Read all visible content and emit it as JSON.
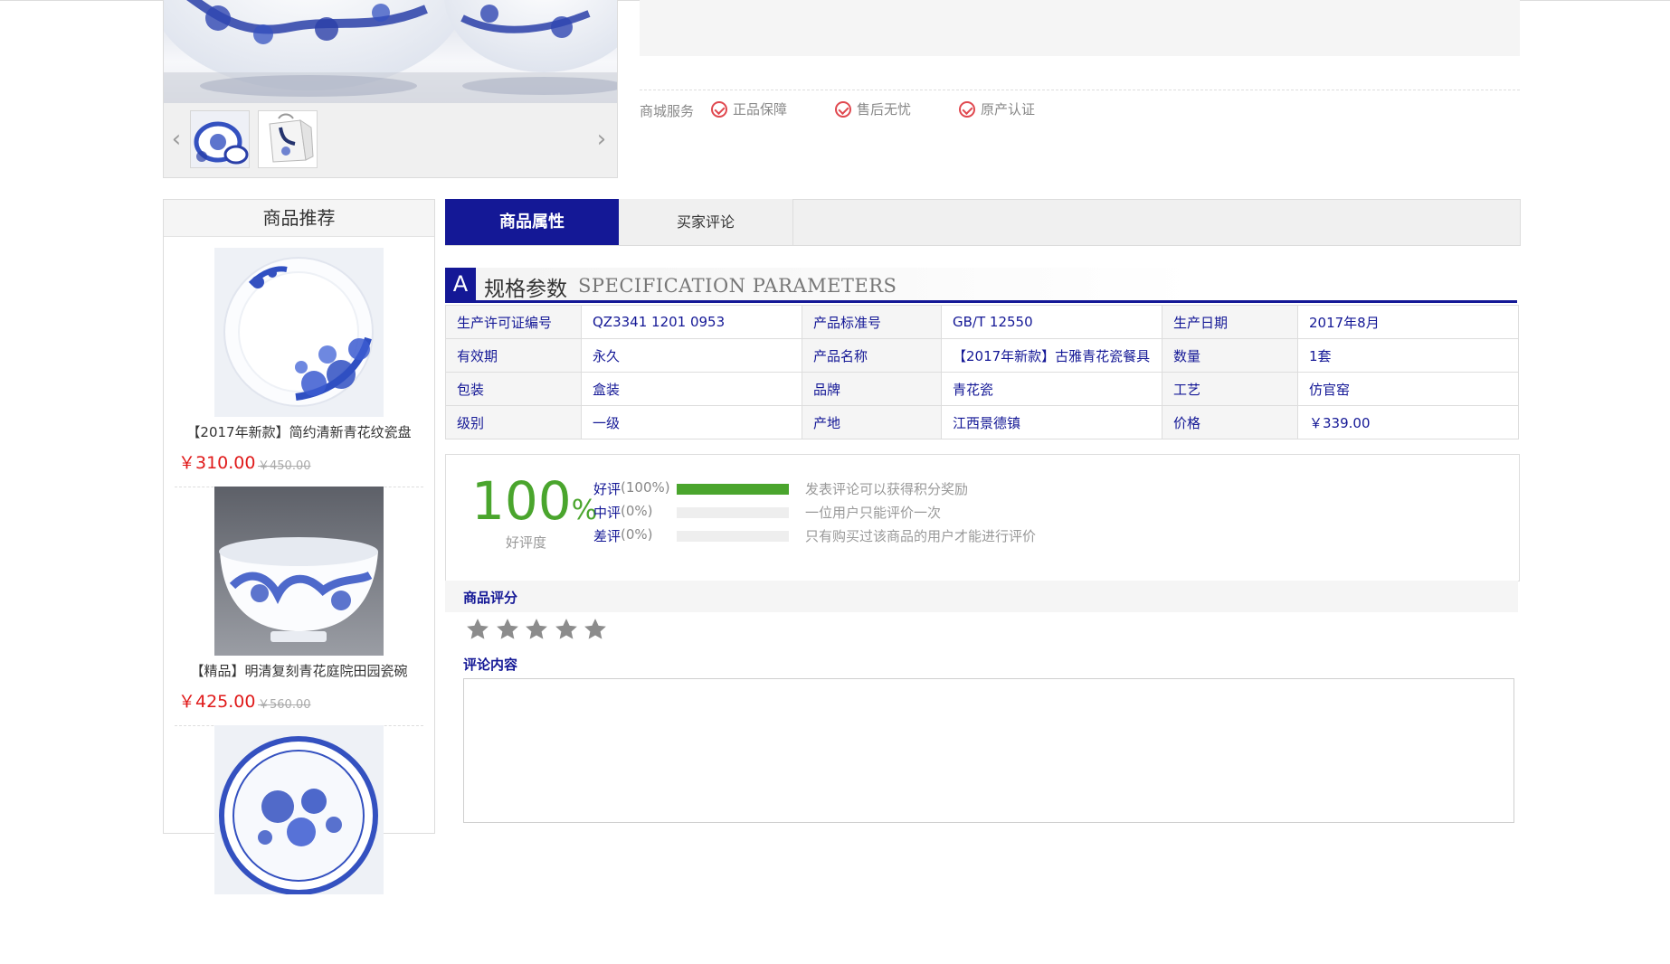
{
  "gallery": {
    "prev_icon": "chevron-left-icon",
    "next_icon": "chevron-right-icon",
    "thumbnails": [
      "blue-white-dinnerware-set",
      "gift-box-packaging"
    ]
  },
  "services": {
    "label": "商城服务",
    "items": [
      "正品保障",
      "售后无忧",
      "原产认证"
    ],
    "icon": "check-circle-icon",
    "icon_color": "#e0484f"
  },
  "sidebar": {
    "title": "商品推荐",
    "items": [
      {
        "name": "【2017年新款】简约清新青花纹瓷盘",
        "price": "￥310.00",
        "old_price": "￥450.00"
      },
      {
        "name": "【精品】明清复刻青花庭院田园瓷碗",
        "price": "￥425.00",
        "old_price": "￥560.00"
      }
    ]
  },
  "tabs": [
    {
      "label": "商品属性",
      "active": true
    },
    {
      "label": "买家评论",
      "active": false
    }
  ],
  "spec": {
    "letter": "A",
    "title_cn": "规格参数",
    "title_en": "SPECIFICATION PARAMETERS",
    "rows": [
      [
        [
          "生产许可证编号",
          "QZ3341 1201 0953"
        ],
        [
          "产品标准号",
          "GB/T 12550"
        ],
        [
          "生产日期",
          "2017年8月"
        ]
      ],
      [
        [
          "有效期",
          "永久"
        ],
        [
          "产品名称",
          "【2017年新款】古雅青花瓷餐具"
        ],
        [
          "数量",
          "1套"
        ]
      ],
      [
        [
          "包装",
          "盒装"
        ],
        [
          "品牌",
          "青花瓷"
        ],
        [
          "工艺",
          "仿官窑"
        ]
      ],
      [
        [
          "级别",
          "一级"
        ],
        [
          "产地",
          "江西景德镇"
        ],
        [
          "价格",
          "￥339.00"
        ]
      ]
    ]
  },
  "rating": {
    "percent": "100",
    "percent_sign": "%",
    "label": "好评度",
    "rows": [
      {
        "name": "好评",
        "pct": "(100%)",
        "fill": 1.0,
        "tip": "发表评论可以获得积分奖励"
      },
      {
        "name": "中评",
        "pct": "(0%)",
        "fill": 0,
        "tip": "一位用户只能评价一次"
      },
      {
        "name": "差评",
        "pct": "(0%)",
        "fill": 0,
        "tip": "只有购买过该商品的用户才能进行评价"
      }
    ],
    "bar_color": "#4aa52d"
  },
  "review": {
    "score_title": "商品评分",
    "stars_total": 5,
    "stars_selected": 0,
    "comment_title": "评论内容",
    "comment_value": ""
  },
  "colors": {
    "brand": "#141896",
    "price": "#e01a1a"
  }
}
